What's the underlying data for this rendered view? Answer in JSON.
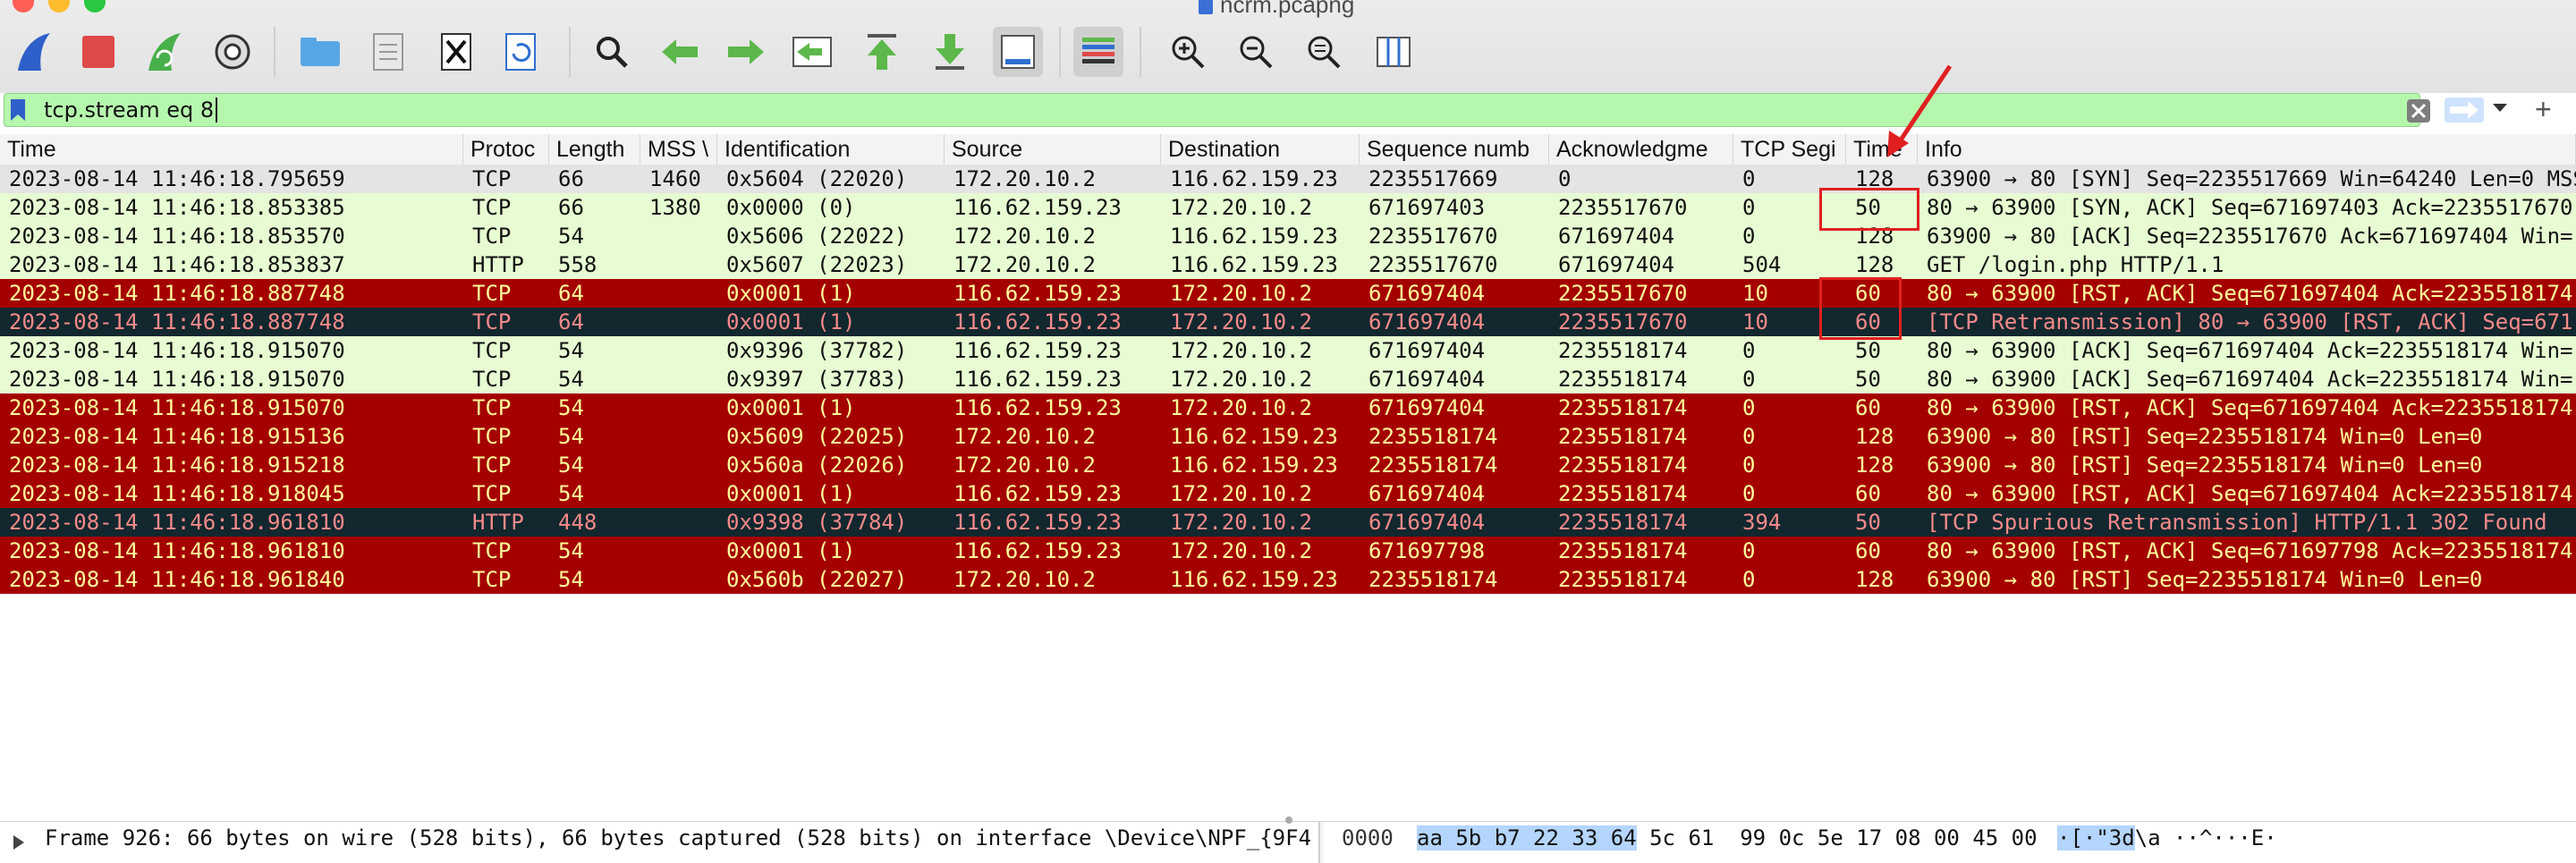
{
  "window": {
    "title": "ncrm.pcapng"
  },
  "toolbar": {
    "icons": [
      "shark-fin-icon",
      "stop-icon",
      "restart-icon",
      "options-gear-icon",
      "open-folder-icon",
      "file-icon",
      "close-file-icon",
      "reload-icon",
      "find-icon",
      "back-arrow-icon",
      "forward-arrow-icon",
      "go-to-packet-icon",
      "first-packet-icon",
      "last-packet-icon",
      "autoscroll-icon",
      "colorize-icon",
      "zoom-in-icon",
      "zoom-out-icon",
      "zoom-normal-icon",
      "resize-columns-icon"
    ]
  },
  "filter": {
    "value": "tcp.stream eq 8"
  },
  "columns": [
    "Time",
    "Protoc",
    "Length",
    "MSS \\",
    "Identification",
    "Source",
    "Destination",
    "Sequence numb",
    "Acknowledgme",
    "TCP Segi",
    "Time",
    "Info"
  ],
  "rows": [
    {
      "time": "2023-08-14 11:46:18.795659",
      "proto": "TCP",
      "len": "66",
      "mss": "1460",
      "id": "0x5604 (22020)",
      "src": "172.20.10.2",
      "dst": "116.62.159.23",
      "seq": "2235517669",
      "ack": "0",
      "tcps": "0",
      "ttl": "128",
      "info": "63900 → 80 [SYN] Seq=2235517669 Win=64240 Len=0 MSS=1460",
      "style": "selected"
    },
    {
      "time": "2023-08-14 11:46:18.853385",
      "proto": "TCP",
      "len": "66",
      "mss": "1380",
      "id": "0x0000 (0)",
      "src": "116.62.159.23",
      "dst": "172.20.10.2",
      "seq": "671697403",
      "ack": "2235517670",
      "tcps": "0",
      "ttl": "50",
      "info": "80 → 63900 [SYN, ACK] Seq=671697403 Ack=2235517670 Win=",
      "style": "green"
    },
    {
      "time": "2023-08-14 11:46:18.853570",
      "proto": "TCP",
      "len": "54",
      "mss": "",
      "id": "0x5606 (22022)",
      "src": "172.20.10.2",
      "dst": "116.62.159.23",
      "seq": "2235517670",
      "ack": "671697404",
      "tcps": "0",
      "ttl": "128",
      "info": "63900 → 80 [ACK] Seq=2235517670 Ack=671697404 Win=",
      "style": "green"
    },
    {
      "time": "2023-08-14 11:46:18.853837",
      "proto": "HTTP",
      "len": "558",
      "mss": "",
      "id": "0x5607 (22023)",
      "src": "172.20.10.2",
      "dst": "116.62.159.23",
      "seq": "2235517670",
      "ack": "671697404",
      "tcps": "504",
      "ttl": "128",
      "info": "GET /login.php HTTP/1.1",
      "style": "green"
    },
    {
      "time": "2023-08-14 11:46:18.887748",
      "proto": "TCP",
      "len": "64",
      "mss": "",
      "id": "0x0001 (1)",
      "src": "116.62.159.23",
      "dst": "172.20.10.2",
      "seq": "671697404",
      "ack": "2235517670",
      "tcps": "10",
      "ttl": "60",
      "info": "80 → 63900 [RST, ACK] Seq=671697404 Ack=2235518174",
      "style": "red"
    },
    {
      "time": "2023-08-14 11:46:18.887748",
      "proto": "TCP",
      "len": "64",
      "mss": "",
      "id": "0x0001 (1)",
      "src": "116.62.159.23",
      "dst": "172.20.10.2",
      "seq": "671697404",
      "ack": "2235517670",
      "tcps": "10",
      "ttl": "60",
      "info": "[TCP Retransmission] 80 → 63900 [RST, ACK] Seq=671",
      "style": "dark"
    },
    {
      "time": "2023-08-14 11:46:18.915070",
      "proto": "TCP",
      "len": "54",
      "mss": "",
      "id": "0x9396 (37782)",
      "src": "116.62.159.23",
      "dst": "172.20.10.2",
      "seq": "671697404",
      "ack": "2235518174",
      "tcps": "0",
      "ttl": "50",
      "info": "80 → 63900 [ACK] Seq=671697404 Ack=2235518174 Win=",
      "style": "green"
    },
    {
      "time": "2023-08-14 11:46:18.915070",
      "proto": "TCP",
      "len": "54",
      "mss": "",
      "id": "0x9397 (37783)",
      "src": "116.62.159.23",
      "dst": "172.20.10.2",
      "seq": "671697404",
      "ack": "2235518174",
      "tcps": "0",
      "ttl": "50",
      "info": "80 → 63900 [ACK] Seq=671697404 Ack=2235518174 Win=",
      "style": "green"
    },
    {
      "time": "2023-08-14 11:46:18.915070",
      "proto": "TCP",
      "len": "54",
      "mss": "",
      "id": "0x0001 (1)",
      "src": "116.62.159.23",
      "dst": "172.20.10.2",
      "seq": "671697404",
      "ack": "2235518174",
      "tcps": "0",
      "ttl": "60",
      "info": "80 → 63900 [RST, ACK] Seq=671697404 Ack=2235518174",
      "style": "red"
    },
    {
      "time": "2023-08-14 11:46:18.915136",
      "proto": "TCP",
      "len": "54",
      "mss": "",
      "id": "0x5609 (22025)",
      "src": "172.20.10.2",
      "dst": "116.62.159.23",
      "seq": "2235518174",
      "ack": "2235518174",
      "tcps": "0",
      "ttl": "128",
      "info": "63900 → 80 [RST] Seq=2235518174 Win=0 Len=0",
      "style": "red"
    },
    {
      "time": "2023-08-14 11:46:18.915218",
      "proto": "TCP",
      "len": "54",
      "mss": "",
      "id": "0x560a (22026)",
      "src": "172.20.10.2",
      "dst": "116.62.159.23",
      "seq": "2235518174",
      "ack": "2235518174",
      "tcps": "0",
      "ttl": "128",
      "info": "63900 → 80 [RST] Seq=2235518174 Win=0 Len=0",
      "style": "red"
    },
    {
      "time": "2023-08-14 11:46:18.918045",
      "proto": "TCP",
      "len": "54",
      "mss": "",
      "id": "0x0001 (1)",
      "src": "116.62.159.23",
      "dst": "172.20.10.2",
      "seq": "671697404",
      "ack": "2235518174",
      "tcps": "0",
      "ttl": "60",
      "info": "80 → 63900 [RST, ACK] Seq=671697404 Ack=2235518174",
      "style": "red"
    },
    {
      "time": "2023-08-14 11:46:18.961810",
      "proto": "HTTP",
      "len": "448",
      "mss": "",
      "id": "0x9398 (37784)",
      "src": "116.62.159.23",
      "dst": "172.20.10.2",
      "seq": "671697404",
      "ack": "2235518174",
      "tcps": "394",
      "ttl": "50",
      "info": "[TCP Spurious Retransmission] HTTP/1.1 302 Found",
      "style": "dark"
    },
    {
      "time": "2023-08-14 11:46:18.961810",
      "proto": "TCP",
      "len": "54",
      "mss": "",
      "id": "0x0001 (1)",
      "src": "116.62.159.23",
      "dst": "172.20.10.2",
      "seq": "671697798",
      "ack": "2235518174",
      "tcps": "0",
      "ttl": "60",
      "info": "80 → 63900 [RST, ACK] Seq=671697798 Ack=2235518174",
      "style": "red"
    },
    {
      "time": "2023-08-14 11:46:18.961840",
      "proto": "TCP",
      "len": "54",
      "mss": "",
      "id": "0x560b (22027)",
      "src": "172.20.10.2",
      "dst": "116.62.159.23",
      "seq": "2235518174",
      "ack": "2235518174",
      "tcps": "0",
      "ttl": "128",
      "info": "63900 → 80 [RST] Seq=2235518174 Win=0 Len=0",
      "style": "red"
    }
  ],
  "row_colors": {
    "selected": {
      "bg": "#e4e4e4",
      "fg": "#111111"
    },
    "green": {
      "bg": "#e7fcd2",
      "fg": "#111111"
    },
    "red": {
      "bg": "#a40000",
      "fg": "#fffc9c"
    },
    "dark": {
      "bg": "#12272e",
      "fg": "#f78a8a"
    }
  },
  "details": {
    "text": "Frame 926: 66 bytes on wire (528 bits), 66 bytes captured (528 bits) on interface \\Device\\NPF_{9F4"
  },
  "hex": {
    "offset": "0000",
    "bytes_hl": "aa 5b b7 22 33 64",
    "bytes_rest": " 5c 61  99 0c 5e 17 08 00 45 00",
    "ascii_hl": "·[·\"3d",
    "ascii_rest": "\\a ··^···E·"
  }
}
